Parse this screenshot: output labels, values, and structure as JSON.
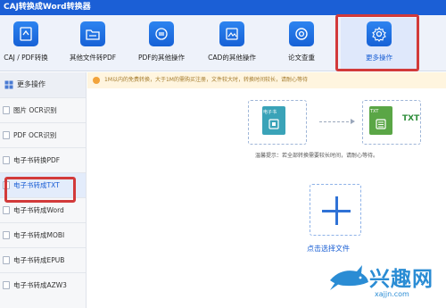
{
  "window": {
    "title": "CAJ转换成Word转换器"
  },
  "toolbar": {
    "tools": [
      {
        "label": "CAJ / PDF转换",
        "icon": "caj-pdf-convert-icon"
      },
      {
        "label": "其他文件转PDF",
        "icon": "folder-icon"
      },
      {
        "label": "PDF的其他操作",
        "icon": "refresh-cycle-icon"
      },
      {
        "label": "CAD的其他操作",
        "icon": "image-frame-icon"
      },
      {
        "label": "论文查重",
        "icon": "at-sign-icon"
      },
      {
        "label": "更多操作",
        "icon": "gear-icon"
      }
    ],
    "active": "更多操作"
  },
  "sidebar": {
    "header": "更多操作",
    "items": [
      {
        "label": "图片 OCR识别"
      },
      {
        "label": "PDF OCR识别"
      },
      {
        "label": "电子书转换PDF"
      },
      {
        "label": "电子书转成TXT"
      },
      {
        "label": "电子书转成Word"
      },
      {
        "label": "电子书转成MOBI"
      },
      {
        "label": "电子书转成EPUB"
      },
      {
        "label": "电子书转成AZW3"
      }
    ],
    "active_index": 3
  },
  "main": {
    "notice": "1M以内的免费转换，大于1M的需购买注册，文件较大时，转换时间较长，请耐心等待",
    "from_label": "电子书",
    "to_label": "TXT",
    "to_label_big": "TXT",
    "tip": "温馨提示：若全部转换需要较长时间，请耐心等待。",
    "upload_label": "点击选择文件"
  },
  "watermark": {
    "text": "兴趣网",
    "url": "xajjn.com"
  },
  "colors": {
    "titlebar": "#1b5fd6",
    "accent": "#1a5fd4",
    "highlight": "#d23a3a",
    "ebook_icon": "#3aa3b8",
    "txt_icon": "#5aa646"
  }
}
